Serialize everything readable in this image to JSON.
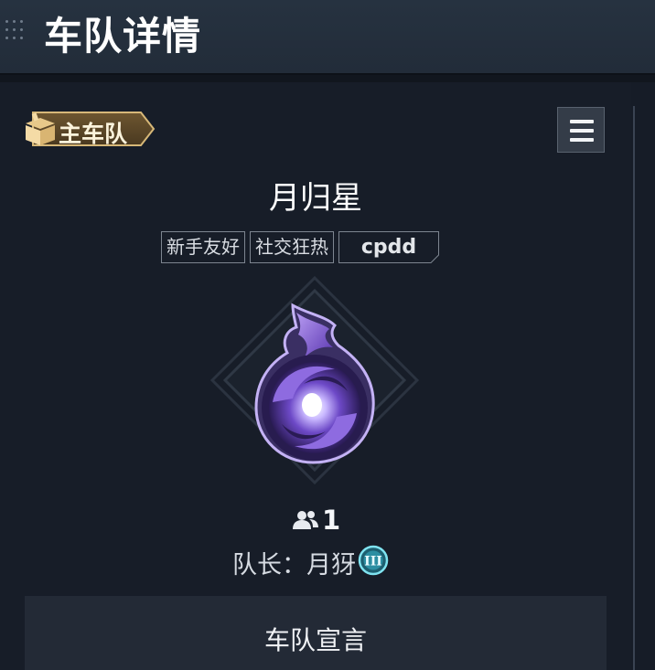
{
  "header": {
    "title": "车队详情"
  },
  "badge": {
    "label": "主车队"
  },
  "team": {
    "name": "月归星",
    "tags": [
      "新手友好",
      "社交狂热",
      "cpdd"
    ],
    "member_count": "1",
    "captain_label": "队长：",
    "captain_name": "月犽",
    "captain_rank": "III"
  },
  "declaration": {
    "title": "车队宣言"
  },
  "colors": {
    "background": "#161c27",
    "header": "#263240",
    "badge_gold": "#c9a66b",
    "emblem_purple": "#7b4fd6",
    "rank_cyan": "#5fd4e6"
  }
}
